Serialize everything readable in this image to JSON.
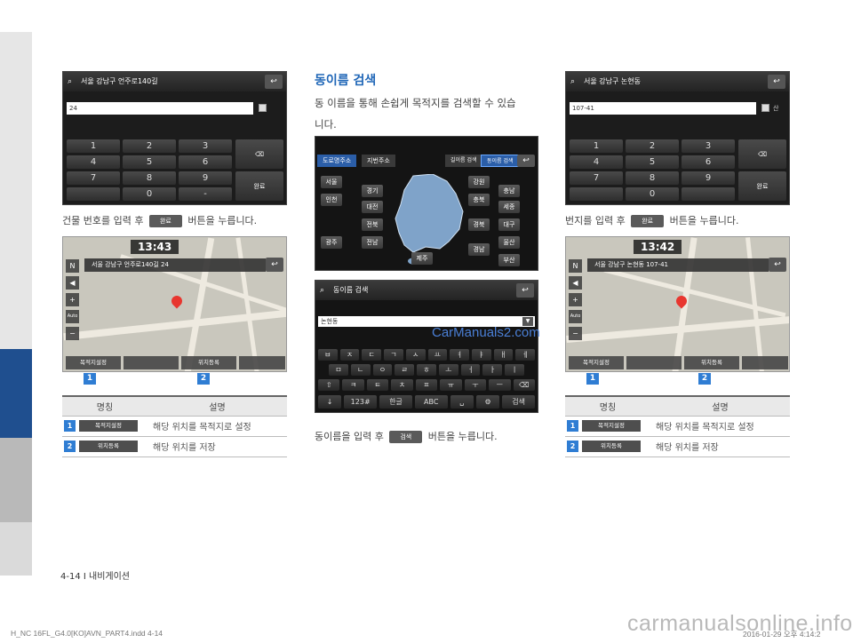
{
  "left_panel": {
    "keypad_screen": {
      "title": "서울 강남구 언주로140길",
      "input_value": "24",
      "keys": [
        "1",
        "2",
        "3",
        "4",
        "5",
        "6",
        "7",
        "8",
        "9",
        "",
        "0",
        "-"
      ],
      "done_label": "완료"
    },
    "caption": {
      "pre": "건물 번호를 입력 후",
      "btn": "완료",
      "post": "버튼을 누릅니다."
    },
    "map_screen": {
      "time": "13:43",
      "address": "서울 강남구 언주로140길 24",
      "tools": [
        "N",
        "+",
        "Auto",
        "−"
      ],
      "btn_set_dest": "목적지설정",
      "btn_save": "위치등록",
      "badges": [
        "1",
        "2"
      ]
    },
    "table": {
      "headers": [
        "명칭",
        "설명"
      ],
      "rows": [
        {
          "num": "1",
          "btn": "목적지설정",
          "desc": "해당 위치를 목적지로 설정"
        },
        {
          "num": "2",
          "btn": "위치등록",
          "desc": "해당 위치를 저장"
        }
      ]
    }
  },
  "middle_panel": {
    "heading": "동이름 검색",
    "para_line1": "동 이름을 통해 손쉽게 목적지를 검색할 수 있습",
    "para_line2": "니다.",
    "region_screen": {
      "tabs": [
        "도로명주소",
        "지번주소",
        "길이름 검색",
        "동이름 검색"
      ],
      "regions": [
        "서울",
        "인천",
        "경기",
        "강원",
        "충북",
        "충남",
        "세종",
        "대전",
        "전북",
        "경북",
        "대구",
        "광주",
        "전남",
        "경남",
        "울산",
        "부산",
        "제주"
      ]
    },
    "keyboard_screen": {
      "title": "동이름 검색",
      "input_value": "논현동",
      "row1": [
        "ㅂ",
        "ㅈ",
        "ㄷ",
        "ㄱ",
        "ㅅ",
        "ㅛ",
        "ㅕ",
        "ㅑ",
        "ㅐ",
        "ㅔ"
      ],
      "row2": [
        "ㅁ",
        "ㄴ",
        "ㅇ",
        "ㄹ",
        "ㅎ",
        "ㅗ",
        "ㅓ",
        "ㅏ",
        "ㅣ"
      ],
      "row3": [
        "⇧",
        "ㅋ",
        "ㅌ",
        "ㅊ",
        "ㅍ",
        "ㅠ",
        "ㅜ",
        "ㅡ",
        "⌫"
      ],
      "row4": [
        "↓",
        "123#",
        "한글",
        "ABC",
        "␣",
        "⚙",
        "검색"
      ]
    },
    "caption": {
      "pre": "동이름을 입력 후",
      "btn": "검색",
      "post": "버튼을 누릅니다."
    }
  },
  "right_panel": {
    "keypad_screen": {
      "title": "서울 강남구 논현동",
      "input_value": "107-41",
      "chk_label": "산",
      "keys": [
        "1",
        "2",
        "3",
        "4",
        "5",
        "6",
        "7",
        "8",
        "9",
        "",
        "0",
        ""
      ],
      "done_label": "완료"
    },
    "caption": {
      "pre": "번지를 입력 후",
      "btn": "완료",
      "post": "버튼을 누릅니다."
    },
    "map_screen": {
      "time": "13:42",
      "address": "서울 강남구 논현동 107-41",
      "tools": [
        "N",
        "+",
        "Auto",
        "−"
      ],
      "btn_set_dest": "목적지설정",
      "btn_save": "위치등록",
      "badges": [
        "1",
        "2"
      ]
    },
    "table": {
      "headers": [
        "명칭",
        "설명"
      ],
      "rows": [
        {
          "num": "1",
          "btn": "목적지설정",
          "desc": "해당 위치를 목적지로 설정"
        },
        {
          "num": "2",
          "btn": "위치등록",
          "desc": "해당 위치를 저장"
        }
      ]
    }
  },
  "watermark": "CarManuals2.com",
  "footer": {
    "page": "4-14 I 내비게이션",
    "print_left": "H_NC 16FL_G4.0[KO]AVN_PART4.indd   4-14",
    "print_right": "2016-01-29   오후 4:14:2",
    "site": "carmanualsonline.info"
  },
  "colors": {
    "accent": "#1f66b7",
    "badge": "#2f7dd3",
    "sidebar_blue": "#1f4f8f"
  }
}
